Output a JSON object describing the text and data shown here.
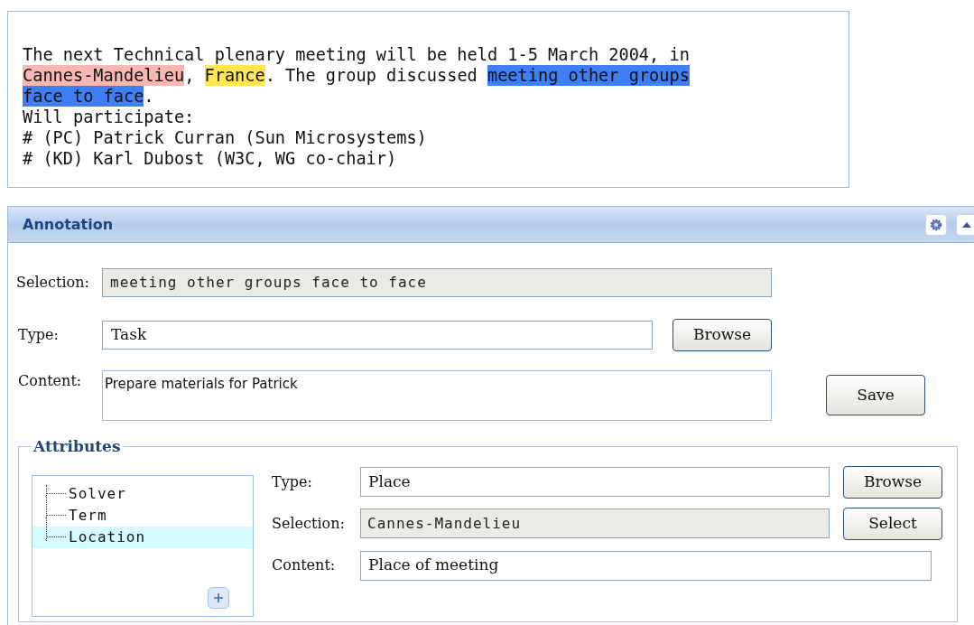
{
  "document": {
    "lines": [
      [
        {
          "text": "The next Technical plenary meeting will be held 1-5 March 2004, in"
        }
      ],
      [
        {
          "text": "Cannes-Mandelieu",
          "color": "#f7b8b4"
        },
        {
          "text": ", "
        },
        {
          "text": "France",
          "color": "#fde64e"
        },
        {
          "text": ". The group discussed "
        },
        {
          "text": "meeting other groups",
          "color": "#3f7ff5"
        }
      ],
      [
        {
          "text": "face to face",
          "color": "#3f7ff5"
        },
        {
          "text": "."
        }
      ],
      [
        {
          "text": "Will participate:"
        }
      ],
      [
        {
          "text": "# (PC) Patrick Curran (Sun Microsystems)"
        }
      ],
      [
        {
          "text": "# (KD) Karl Dubost (W3C, WG co-chair)"
        }
      ]
    ]
  },
  "panel": {
    "title": "Annotation",
    "selection": {
      "label": "Selection:",
      "value": "meeting other groups face to face"
    },
    "type": {
      "label": "Type:",
      "value": "Task"
    },
    "browse_button": "Browse",
    "content": {
      "label": "Content:",
      "value": "Prepare materials for Patrick"
    },
    "save_button": "Save",
    "attributes": {
      "title": "Attributes",
      "tree": [
        {
          "label": "Solver",
          "selected": false
        },
        {
          "label": "Term",
          "selected": false
        },
        {
          "label": "Location",
          "selected": true
        }
      ],
      "type": {
        "label": "Type:",
        "value": "Place"
      },
      "browse_button": "Browse",
      "selection": {
        "label": "Selection:",
        "value": "Cannes-Mandelieu"
      },
      "select_button": "Select",
      "content": {
        "label": "Content:",
        "value": "Place of meeting"
      }
    }
  }
}
